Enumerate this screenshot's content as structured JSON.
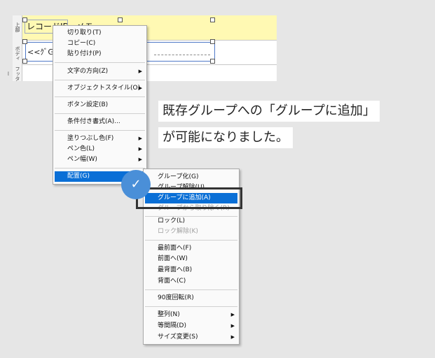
{
  "designer": {
    "ruler_labels": [
      "上部",
      "ボディ",
      "フッター"
    ],
    "header_label": "レコードID",
    "header_text": "メモ",
    "body_field": "<<ｸﾞGe..."
  },
  "menu1": {
    "items": [
      {
        "label": "切り取り(T)"
      },
      {
        "label": "コピー(C)"
      },
      {
        "label": "貼り付け(P)"
      },
      {
        "label": "文字の方向(Z)"
      },
      {
        "label": "オブジェクトスタイル(O)"
      },
      {
        "label": "ボタン設定(B)"
      },
      {
        "label": "条件付き書式(A)..."
      },
      {
        "label": "塗りつぶし色(F)"
      },
      {
        "label": "ペン色(L)"
      },
      {
        "label": "ペン幅(W)"
      },
      {
        "label": "配置(G)"
      }
    ]
  },
  "menu2": {
    "items": [
      {
        "label": "グループ化(G)"
      },
      {
        "label": "グループ解除(U)"
      },
      {
        "label": "グループに追加(A)"
      },
      {
        "label": "グループから取り除く(R)"
      },
      {
        "label": "ロック(L)"
      },
      {
        "label": "ロック解除(K)"
      },
      {
        "label": "最前面へ(F)"
      },
      {
        "label": "前面へ(W)"
      },
      {
        "label": "最背面へ(B)"
      },
      {
        "label": "背面へ(C)"
      },
      {
        "label": "90度回転(R)"
      },
      {
        "label": "整列(N)"
      },
      {
        "label": "等間隔(D)"
      },
      {
        "label": "サイズ変更(S)"
      }
    ]
  },
  "callout": {
    "line1": "既存グループへの「グループに追加」",
    "line2": "が可能になりました。"
  },
  "check_symbol": "✓",
  "submenu_arrow": "▶",
  "colors": {
    "highlight": "#0a6fd6",
    "header_bg": "#fff9b3",
    "check_circle": "#4a8fd8"
  }
}
